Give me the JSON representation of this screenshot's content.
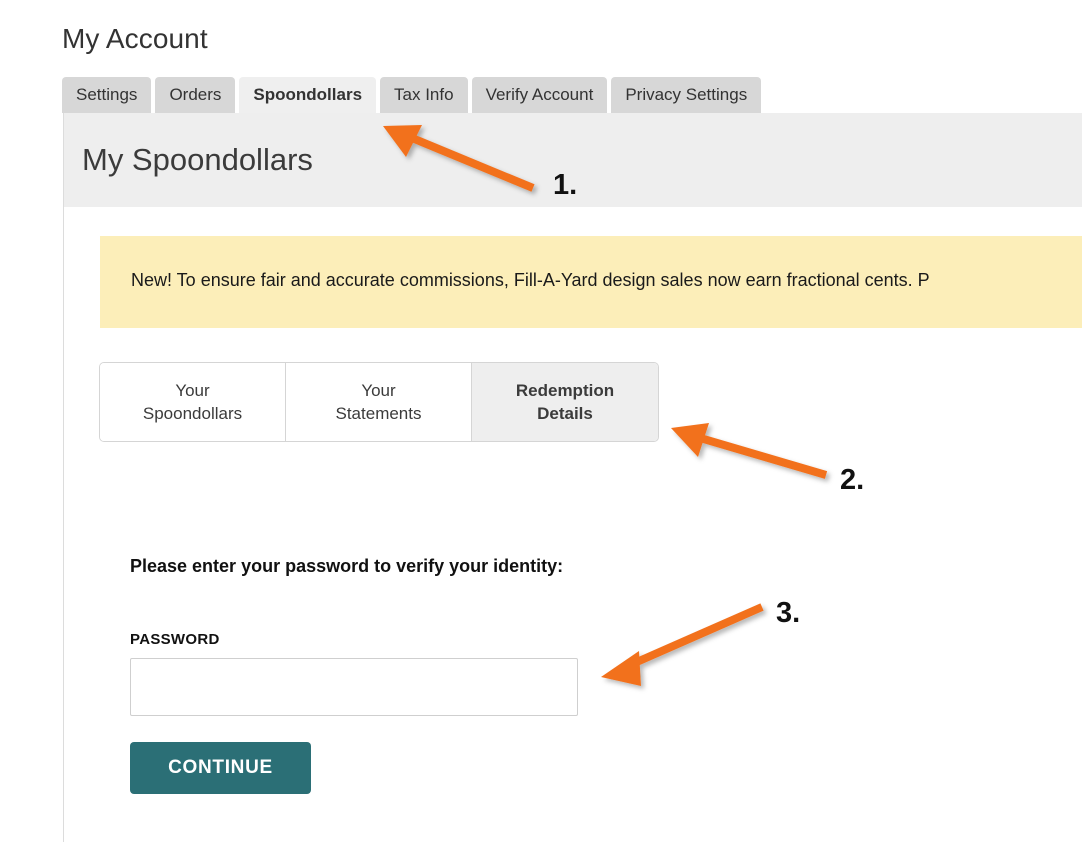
{
  "page": {
    "title": "My Account"
  },
  "account_tabs": [
    {
      "label": "Settings",
      "active": false
    },
    {
      "label": "Orders",
      "active": false
    },
    {
      "label": "Spoondollars",
      "active": true
    },
    {
      "label": "Tax Info",
      "active": false
    },
    {
      "label": "Verify Account",
      "active": false
    },
    {
      "label": "Privacy Settings",
      "active": false
    }
  ],
  "section": {
    "heading": "My Spoondollars"
  },
  "notice": {
    "text": "New! To ensure fair and accurate commissions, Fill-A-Yard design sales now earn fractional cents. P"
  },
  "subtabs": [
    {
      "label_line1": "Your",
      "label_line2": "Spoondollars",
      "active": false
    },
    {
      "label_line1": "Your",
      "label_line2": "Statements",
      "active": false
    },
    {
      "label_line1": "Redemption",
      "label_line2": "Details",
      "active": true
    }
  ],
  "form": {
    "prompt": "Please enter your password to verify your identity:",
    "password_label": "PASSWORD",
    "password_value": "",
    "password_placeholder": "",
    "continue_label": "CONTINUE"
  },
  "annotations": [
    {
      "number": "1.",
      "target": "spoondollars-account-tab"
    },
    {
      "number": "2.",
      "target": "redemption-details-subtab"
    },
    {
      "number": "3.",
      "target": "password-input"
    }
  ],
  "colors": {
    "accent_button": "#2b6f76",
    "notice_background": "#fceeb9",
    "annotation_orange": "#f2711c",
    "tab_inactive": "#d7d7d7",
    "tab_active": "#efefef"
  }
}
